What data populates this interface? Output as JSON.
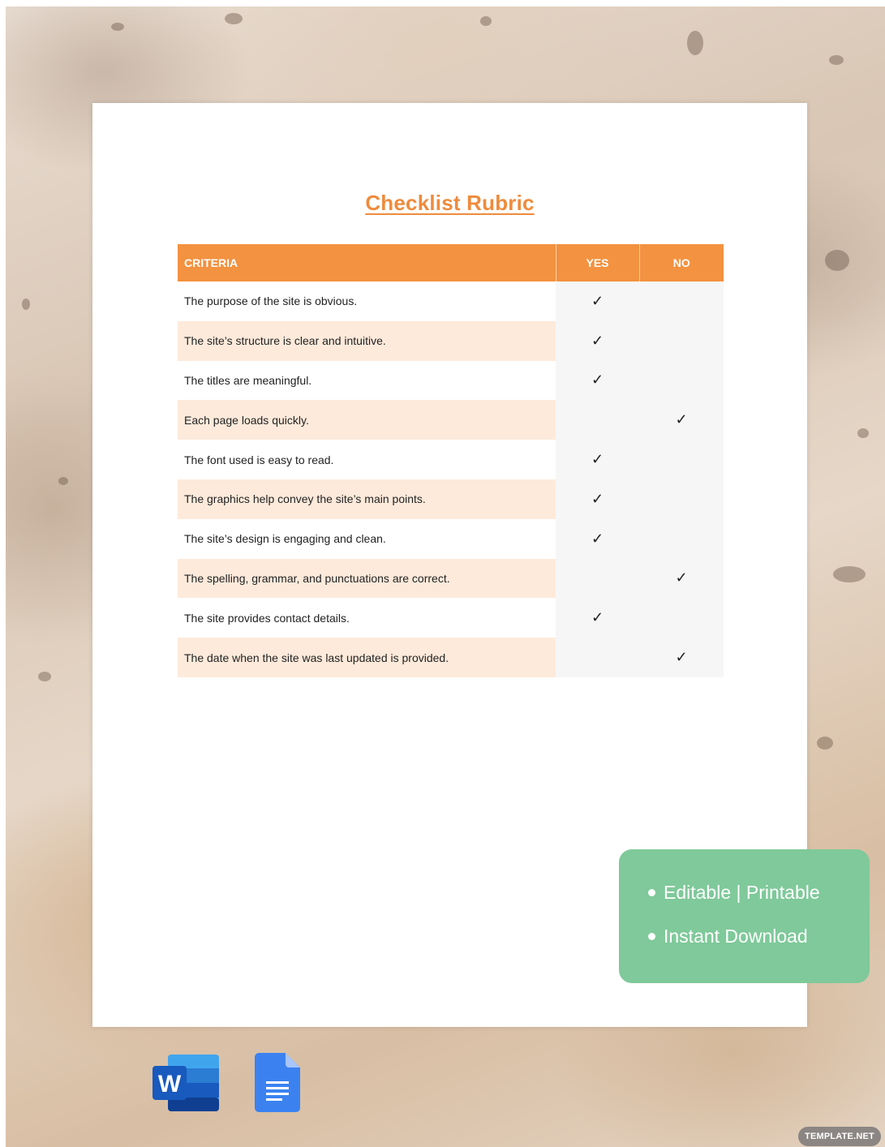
{
  "document": {
    "title": "Checklist Rubric",
    "columns": {
      "criteria": "CRITERIA",
      "yes": "YES",
      "no": "NO"
    },
    "check_glyph": "✓",
    "rows": [
      {
        "criteria": "The purpose of the site is obvious.",
        "yes": "✓",
        "no": ""
      },
      {
        "criteria": "The site’s structure is clear and intuitive.",
        "yes": "✓",
        "no": ""
      },
      {
        "criteria": "The titles are meaningful.",
        "yes": "✓",
        "no": ""
      },
      {
        "criteria": "Each page loads quickly.",
        "yes": "",
        "no": "✓"
      },
      {
        "criteria": "The font used is easy to read.",
        "yes": "✓",
        "no": ""
      },
      {
        "criteria": "The graphics help convey the site’s main points.",
        "yes": "✓",
        "no": ""
      },
      {
        "criteria": "The site’s design is engaging and clean.",
        "yes": "✓",
        "no": ""
      },
      {
        "criteria": "The spelling, grammar, and punctuations are correct.",
        "yes": "",
        "no": "✓"
      },
      {
        "criteria": "The site provides contact details.",
        "yes": "✓",
        "no": ""
      },
      {
        "criteria": "The date when the site was last updated is provided.",
        "yes": "",
        "no": "✓"
      }
    ]
  },
  "features_badge": {
    "items": [
      "Editable | Printable",
      "Instant Download"
    ]
  },
  "app_icons": [
    {
      "name": "word-icon",
      "letter": "W"
    },
    {
      "name": "google-docs-icon",
      "letter": ""
    }
  ],
  "watermark": "TEMPLATE.NET",
  "colors": {
    "title": "#ef8b3c",
    "header_bg": "#f39240",
    "row_alt_bg": "#fdeadb",
    "badge_bg": "#7fc99a",
    "word_blue": "#2b5cc4",
    "docs_blue": "#3b82f0"
  }
}
